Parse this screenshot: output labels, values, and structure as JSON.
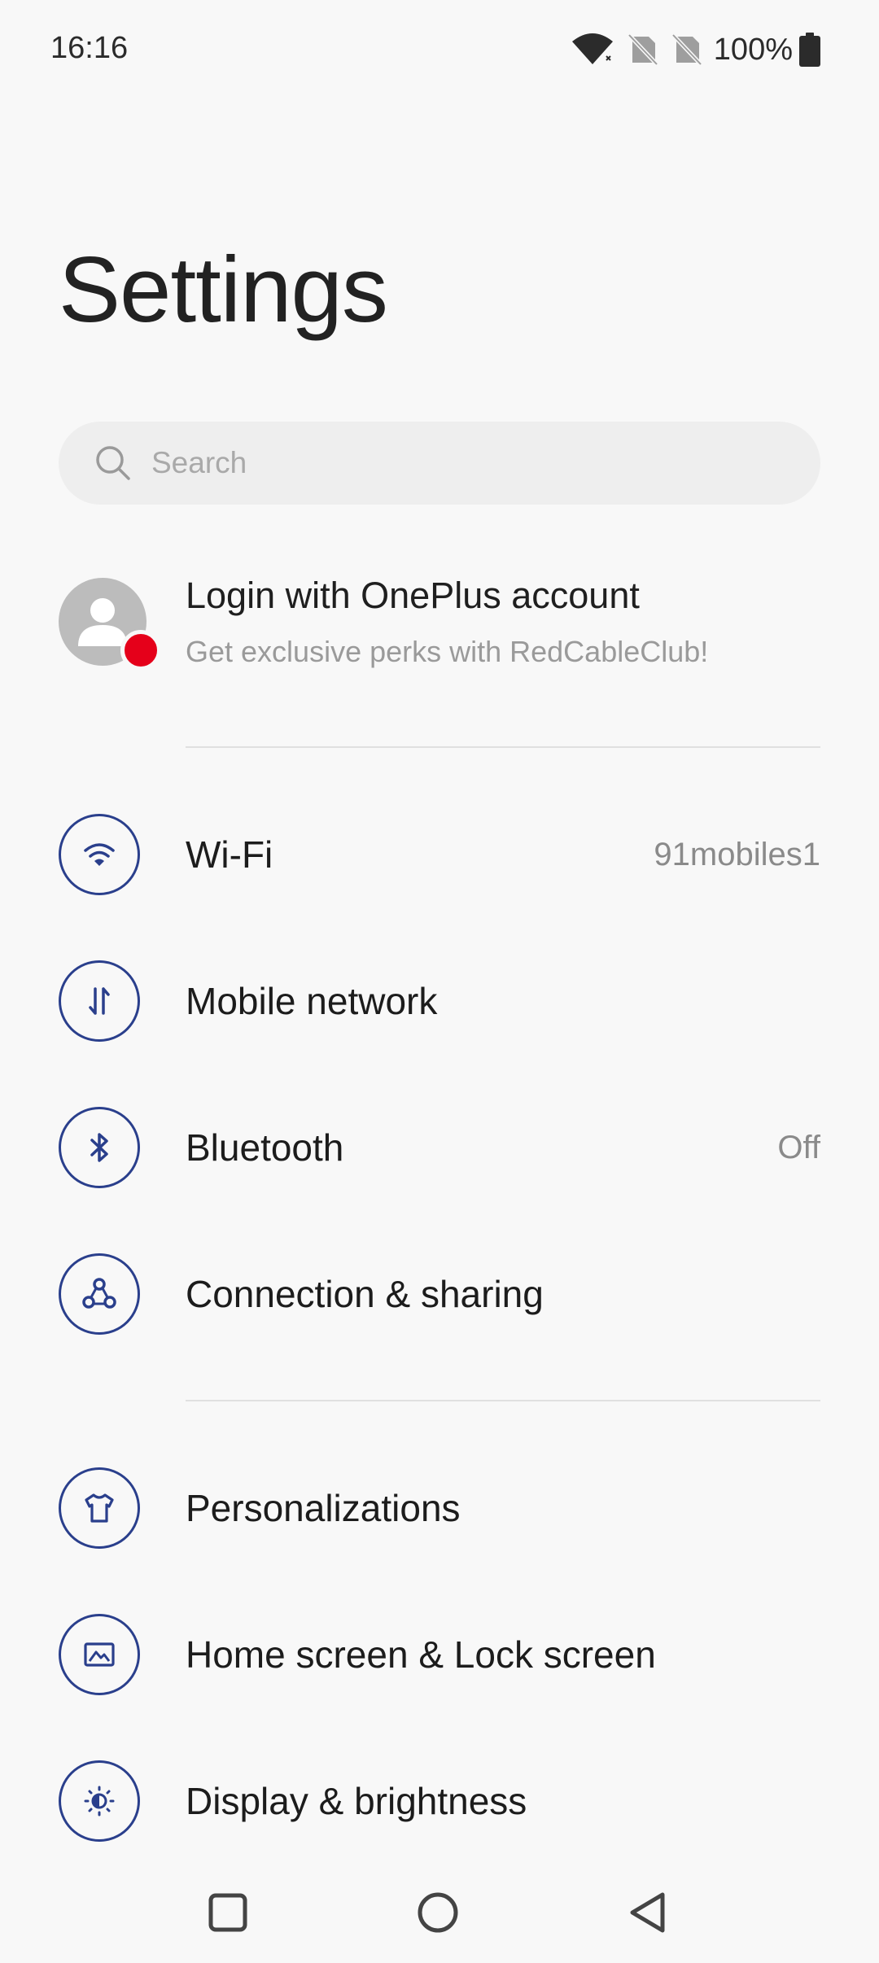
{
  "status_bar": {
    "time": "16:16",
    "battery_percent": "100%",
    "icons": [
      "wifi-icon",
      "no-sim-icon",
      "no-sim-icon",
      "battery-icon"
    ]
  },
  "page": {
    "title": "Settings"
  },
  "search": {
    "placeholder": "Search",
    "value": ""
  },
  "account": {
    "title": "Login with OnePlus account",
    "subtitle": "Get exclusive perks with RedCableClub!",
    "badge_color": "#e5001a"
  },
  "settings": {
    "wifi": {
      "label": "Wi-Fi",
      "value": "91mobiles1",
      "icon": "wifi-icon"
    },
    "mobile_network": {
      "label": "Mobile network",
      "icon": "mobile-data-icon"
    },
    "bluetooth": {
      "label": "Bluetooth",
      "value": "Off",
      "icon": "bluetooth-icon"
    },
    "connection_sharing": {
      "label": "Connection & sharing",
      "icon": "connection-icon"
    },
    "personalizations": {
      "label": "Personalizations",
      "icon": "tshirt-icon"
    },
    "home_lock_screen": {
      "label": "Home screen & Lock screen",
      "icon": "picture-icon"
    },
    "display_brightness": {
      "label": "Display & brightness",
      "icon": "brightness-icon"
    }
  },
  "nav_bar": {
    "buttons": [
      "recents-icon",
      "home-icon",
      "back-icon"
    ]
  },
  "colors": {
    "accent": "#2a3f8c",
    "background": "#f8f8f8",
    "search_bg": "#eeeeee"
  }
}
